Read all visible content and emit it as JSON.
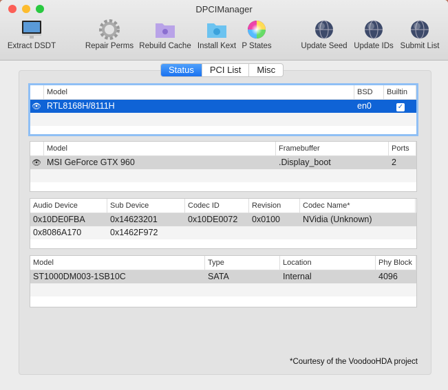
{
  "window": {
    "title": "DPCIManager"
  },
  "toolbar": [
    {
      "label": "Extract DSDT",
      "icon": "imac-icon"
    },
    {
      "label": "Repair Perms",
      "icon": "gear-icon"
    },
    {
      "label": "Rebuild Cache",
      "icon": "purple-folder-icon"
    },
    {
      "label": "Install Kext",
      "icon": "blue-folder-icon"
    },
    {
      "label": "P States",
      "icon": "color-wheel-icon"
    },
    {
      "label": "Update Seed",
      "icon": "globe-icon"
    },
    {
      "label": "Update IDs",
      "icon": "globe-icon"
    },
    {
      "label": "Submit List",
      "icon": "globe-icon"
    }
  ],
  "tabs": [
    {
      "label": "Status",
      "active": true
    },
    {
      "label": "PCI List"
    },
    {
      "label": "Misc"
    }
  ],
  "tables": [
    {
      "name": "network",
      "headers": [
        "Model",
        "BSD",
        "Builtin"
      ],
      "rows": [
        [
          "RTL8168H/8111H",
          "en0",
          "✓"
        ]
      ]
    },
    {
      "name": "graphics",
      "headers": [
        "Model",
        "Framebuffer",
        "Ports"
      ],
      "rows": [
        [
          "MSI GeForce GTX 960",
          ".Display_boot",
          "2"
        ]
      ]
    },
    {
      "name": "audio",
      "headers": [
        "Audio Device",
        "Sub Device",
        "Codec ID",
        "Revision",
        "Codec Name*"
      ],
      "rows": [
        [
          "0x10DE0FBA",
          "0x14623201",
          "0x10DE0072",
          "0x0100",
          "NVidia (Unknown)"
        ],
        [
          "0x8086A170",
          "0x1462F972",
          "",
          "",
          ""
        ]
      ]
    },
    {
      "name": "storage",
      "headers": [
        "Model",
        "Type",
        "Location",
        "Phy Block"
      ],
      "rows": [
        [
          "ST1000DM003-1SB10C",
          "SATA",
          "Internal",
          "4096"
        ]
      ]
    }
  ],
  "footer": "*Courtesy of the VoodooHDA project"
}
